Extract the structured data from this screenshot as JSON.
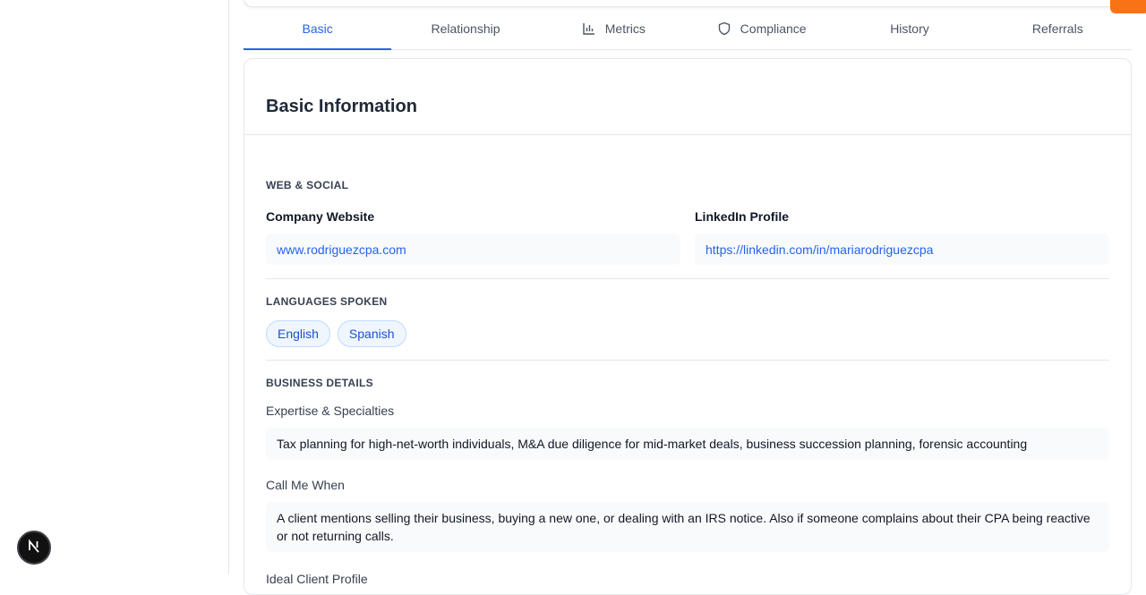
{
  "tabs": [
    {
      "label": "Basic",
      "icon": "",
      "active": true
    },
    {
      "label": "Relationship",
      "icon": "",
      "active": false
    },
    {
      "label": "Metrics",
      "icon": "bar-chart-icon",
      "active": false
    },
    {
      "label": "Compliance",
      "icon": "shield-icon",
      "active": false
    },
    {
      "label": "History",
      "icon": "",
      "active": false
    },
    {
      "label": "Referrals",
      "icon": "",
      "active": false
    }
  ],
  "card": {
    "title": "Basic Information"
  },
  "web_social": {
    "title": "WEB & SOCIAL",
    "website_label": "Company Website",
    "website_value": "www.rodriguezcpa.com",
    "linkedin_label": "LinkedIn Profile",
    "linkedin_value": "https://linkedin.com/in/mariarodriguezcpa"
  },
  "languages": {
    "title": "LANGUAGES SPOKEN",
    "items": [
      "English",
      "Spanish"
    ]
  },
  "business": {
    "title": "BUSINESS DETAILS",
    "expertise_label": "Expertise & Specialties",
    "expertise_value": "Tax planning for high-net-worth individuals, M&A due diligence for mid-market deals, business succession planning, forensic accounting",
    "call_label": "Call Me When",
    "call_value": "A client mentions selling their business, buying a new one, or dealing with an IRS notice. Also if someone complains about their CPA being reactive or not returning calls.",
    "ideal_label": "Ideal Client Profile"
  },
  "badge": {
    "letter": "N"
  },
  "colors": {
    "accent": "#2563eb",
    "orange": "#f97316"
  }
}
